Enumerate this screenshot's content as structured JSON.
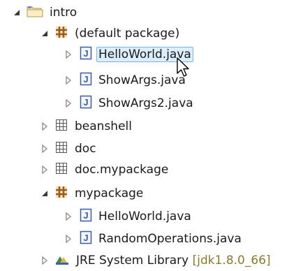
{
  "colors": {
    "selection_bg": "#dceefc",
    "selection_border": "#7fb4e6",
    "package_brown": "#9b5a1a",
    "java_blue": "#3b5da8",
    "version_gold": "#8a7a2c"
  },
  "tree": {
    "project": {
      "label": "intro",
      "icon": "folder-project-icon",
      "expanded": true
    },
    "default_package": {
      "label": "(default package)",
      "icon": "package-icon",
      "expanded": true,
      "files": [
        {
          "label": "HelloWorld.java",
          "icon": "java-file-icon",
          "selected": true
        },
        {
          "label": "ShowArgs.java",
          "icon": "java-file-icon"
        },
        {
          "label": "ShowArgs2.java",
          "icon": "java-file-icon"
        }
      ]
    },
    "collapsed_packages": [
      {
        "label": "beanshell",
        "icon": "empty-package-icon"
      },
      {
        "label": "doc",
        "icon": "empty-package-icon"
      },
      {
        "label": "doc.mypackage",
        "icon": "empty-package-icon"
      }
    ],
    "mypackage": {
      "label": "mypackage",
      "icon": "package-icon",
      "expanded": true,
      "files": [
        {
          "label": "HelloWorld.java",
          "icon": "java-file-icon"
        },
        {
          "label": "RandomOperations.java",
          "icon": "java-file-icon"
        }
      ]
    },
    "jre": {
      "label": "JRE System Library",
      "version": "[jdk1.8.0_66]",
      "icon": "library-icon"
    }
  }
}
